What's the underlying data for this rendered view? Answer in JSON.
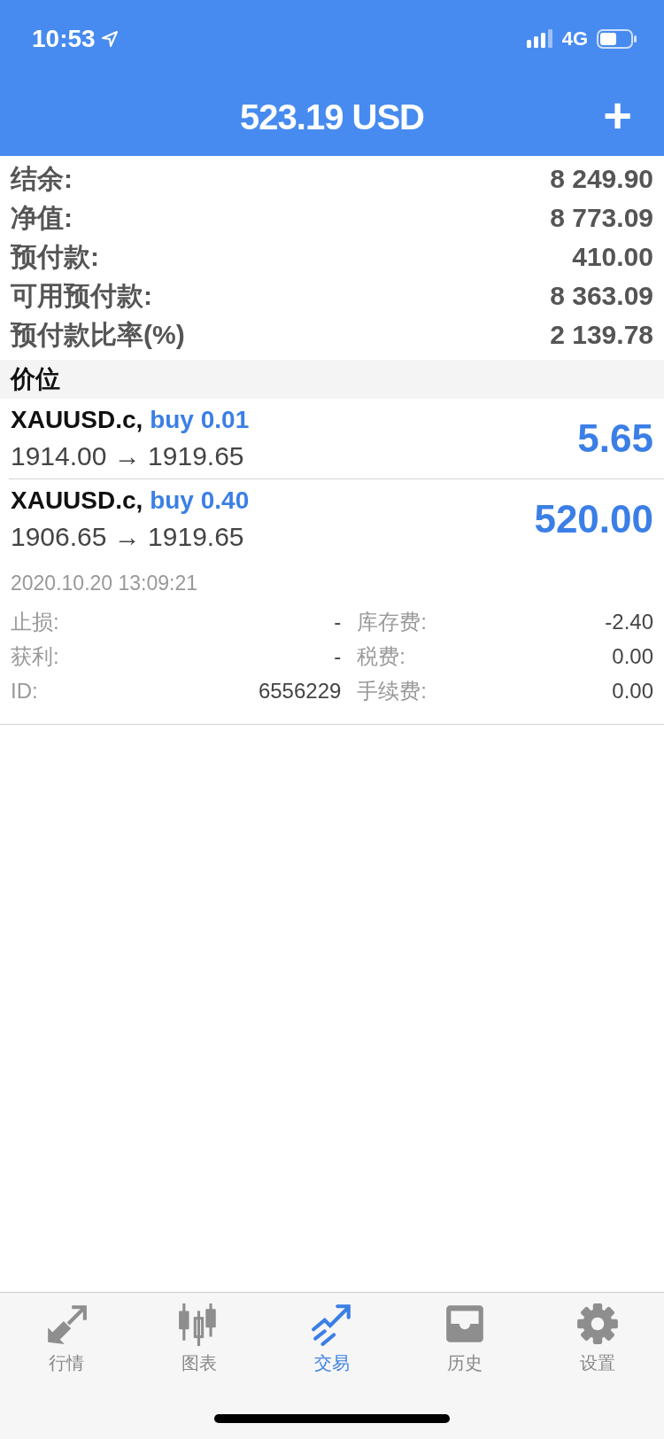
{
  "status_bar": {
    "time": "10:53",
    "network": "4G"
  },
  "header": {
    "title": "523.19 USD",
    "add_button": "+"
  },
  "summary": [
    {
      "label": "结余:",
      "value": "8 249.90"
    },
    {
      "label": "净值:",
      "value": "8 773.09"
    },
    {
      "label": "预付款:",
      "value": "410.00"
    },
    {
      "label": "可用预付款:",
      "value": "8 363.09"
    },
    {
      "label": "预付款比率(%)",
      "value": "2 139.78"
    }
  ],
  "section_title": "价位",
  "positions": [
    {
      "symbol": "XAUUSD.c,",
      "order": "buy 0.01",
      "prices": "1914.00 → 1919.65",
      "profit": "5.65",
      "expanded": false
    },
    {
      "symbol": "XAUUSD.c,",
      "order": "buy 0.40",
      "prices": "1906.65 → 1919.65",
      "profit": "520.00",
      "expanded": true,
      "time": "2020.10.20 13:09:21",
      "details": [
        {
          "label": "止损:",
          "value": "-",
          "label_2": "库存费:",
          "value_2": "-2.40"
        },
        {
          "label": "获利:",
          "value": "-",
          "label_2": "税费:",
          "value_2": "0.00"
        },
        {
          "label": "ID:",
          "value": "6556229",
          "label_2": "手续费:",
          "value_2": "0.00"
        }
      ]
    }
  ],
  "tabs": [
    {
      "kind": "quotes",
      "label": "行情",
      "selected": false
    },
    {
      "kind": "chart",
      "label": "图表",
      "selected": false
    },
    {
      "kind": "trade",
      "label": "交易",
      "selected": true
    },
    {
      "kind": "history",
      "label": "历史",
      "selected": false
    },
    {
      "kind": "settings",
      "label": "设置",
      "selected": false
    }
  ]
}
